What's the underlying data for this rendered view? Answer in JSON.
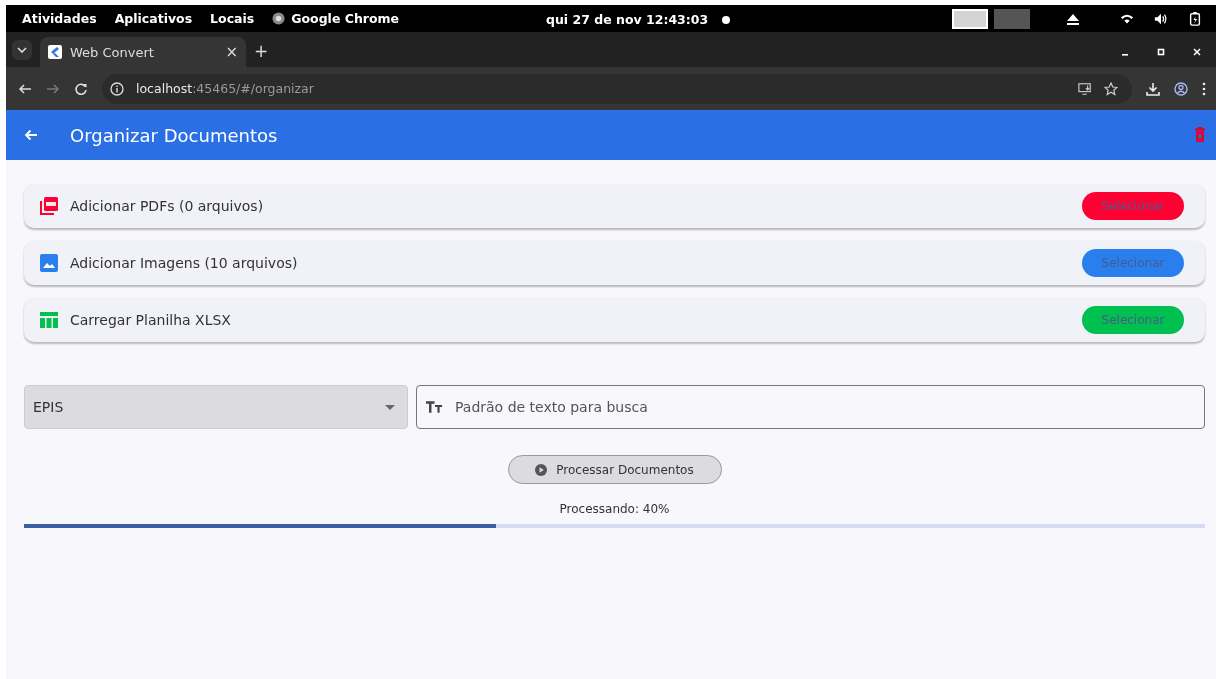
{
  "top_bar": {
    "menus": [
      "Atividades",
      "Aplicativos",
      "Locais"
    ],
    "app": "Google Chrome",
    "clock": "qui 27 de nov  12:43:03",
    "workspaces": [
      {
        "selected": true
      },
      {
        "selected": false
      }
    ]
  },
  "browser": {
    "tab": {
      "title": "Web Convert",
      "close": "×"
    },
    "new_tab": "+",
    "url_host": "localhost",
    "url_path": ":45465/#/organizar"
  },
  "app_bar": {
    "title": "Organizar Documentos"
  },
  "cards": [
    {
      "kind": "pdf",
      "label": "Adicionar PDFs (0 arquivos)",
      "button": "Selecionar",
      "color": "#ff0033"
    },
    {
      "kind": "image",
      "label": "Adicionar Imagens (10 arquivos)",
      "button": "Selecionar",
      "color": "#2a7fef"
    },
    {
      "kind": "sheet",
      "label": "Carregar Planilha XLSX",
      "button": "Selecionar",
      "color": "#00c050"
    }
  ],
  "dropdown": {
    "value": "EPIS"
  },
  "search": {
    "placeholder": "Padrão de texto para busca"
  },
  "process_button": "Processar Documentos",
  "progress": {
    "reading": "Processando: 40%",
    "level": 0.4
  }
}
